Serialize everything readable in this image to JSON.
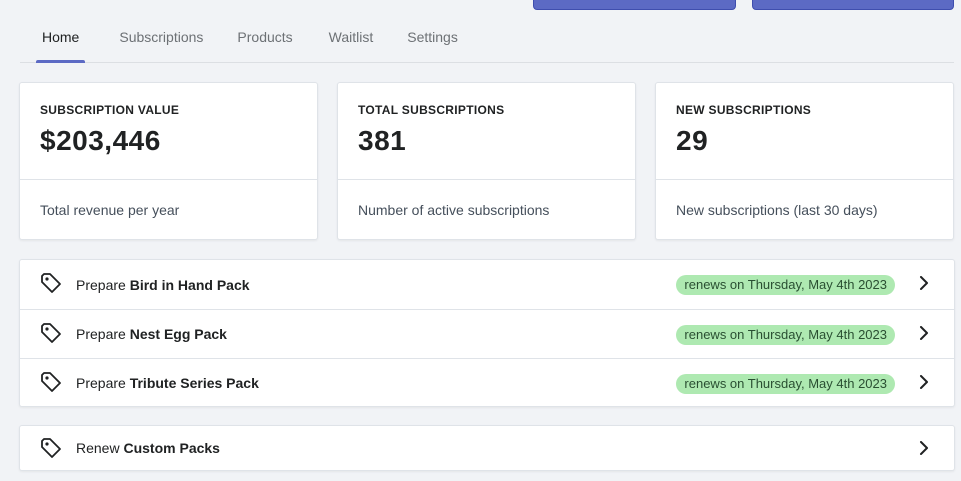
{
  "tabs": [
    "Home",
    "Subscriptions",
    "Products",
    "Waitlist",
    "Settings"
  ],
  "stats": [
    {
      "label": "SUBSCRIPTION VALUE",
      "value": "$203,446",
      "description": "Total revenue per year"
    },
    {
      "label": "TOTAL SUBSCRIPTIONS",
      "value": "381",
      "description": "Number of active subscriptions"
    },
    {
      "label": "NEW SUBSCRIPTIONS",
      "value": "29",
      "description": "New subscriptions (last 30 days)"
    }
  ],
  "tasks": [
    {
      "verb": "Prepare",
      "name": "Bird in Hand Pack",
      "badge": "renews on Thursday, May 4th 2023"
    },
    {
      "verb": "Prepare",
      "name": "Nest Egg Pack",
      "badge": "renews on Thursday, May 4th 2023"
    },
    {
      "verb": "Prepare",
      "name": "Tribute Series Pack",
      "badge": "renews on Thursday, May 4th 2023"
    }
  ],
  "custom": {
    "verb": "Renew",
    "name": "Custom Packs"
  },
  "icons": {
    "row_icon": "tag-icon",
    "row_arrow": "chevron-right-icon"
  },
  "colors": {
    "accent": "#5c6ac4",
    "badge_bg": "#aee9b1",
    "background": "#f1f3f6"
  }
}
